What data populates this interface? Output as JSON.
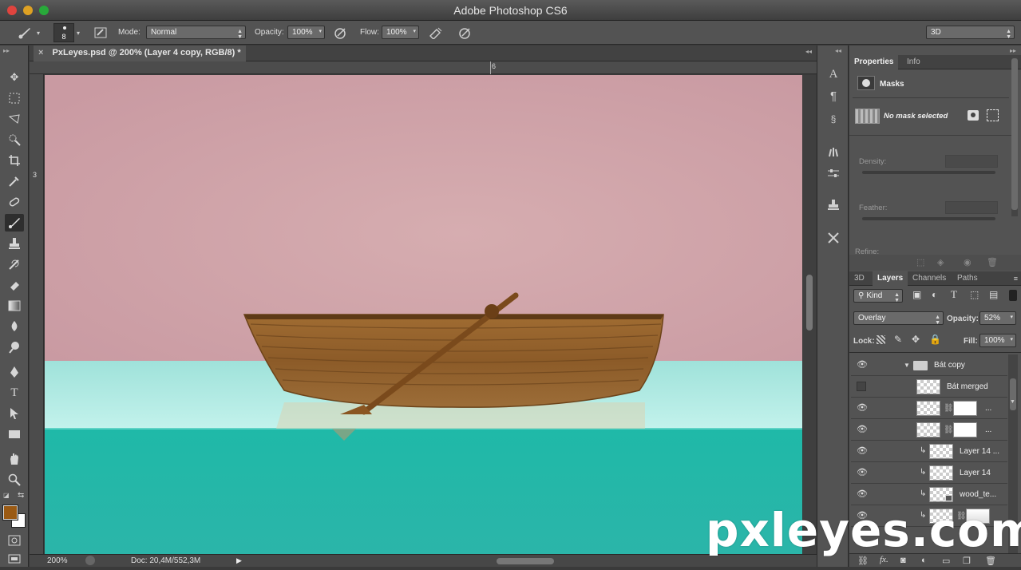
{
  "app": {
    "window_title": "Adobe Photoshop CS6"
  },
  "options_bar": {
    "brush_size": "8",
    "mode_label": "Mode:",
    "mode_value": "Normal",
    "opacity_label": "Opacity:",
    "opacity_value": "100%",
    "flow_label": "Flow:",
    "flow_value": "100%",
    "workspace": "3D"
  },
  "document": {
    "tab_title": "PxLeyes.psd @ 200% (Layer 4 copy, RGB/8) *",
    "ruler_top_mark": "6",
    "ruler_left_mark": "3",
    "zoom": "200%",
    "doc_size": "Doc: 20,4M/552,3M"
  },
  "colors": {
    "foreground": "#9a5a14",
    "background": "#ffffff",
    "sky": "#cfa2a8",
    "water_light": "#a8e6df",
    "water_deep": "#22b5a5",
    "boat_wood": "#9a6a2e"
  },
  "properties_panel": {
    "tabs": [
      "Properties",
      "Info"
    ],
    "title": "Masks",
    "mask_status": "No mask selected",
    "density_label": "Density:",
    "feather_label": "Feather:",
    "refine_label": "Refine:"
  },
  "layers_panel": {
    "tabs": [
      "3D",
      "Layers",
      "Channels",
      "Paths"
    ],
    "filter_kind": "Kind",
    "blend_mode": "Overlay",
    "opacity_label": "Opacity:",
    "opacity_value": "52%",
    "lock_label": "Lock:",
    "fill_label": "Fill:",
    "fill_value": "100%",
    "layers": [
      {
        "name": "Bát copy",
        "type": "group",
        "visible": true
      },
      {
        "name": "Bát merged",
        "type": "layer",
        "visible": false
      },
      {
        "name": "...",
        "type": "masked",
        "visible": true
      },
      {
        "name": "...",
        "type": "masked",
        "visible": true
      },
      {
        "name": "Layer 14 ...",
        "type": "clipped",
        "visible": true
      },
      {
        "name": "Layer 14",
        "type": "clipped",
        "visible": true
      },
      {
        "name": "wood_te...",
        "type": "clipped-smart",
        "visible": true
      },
      {
        "name": "",
        "type": "clipped-masked",
        "visible": true
      }
    ]
  },
  "watermark": "pxleyes.com"
}
